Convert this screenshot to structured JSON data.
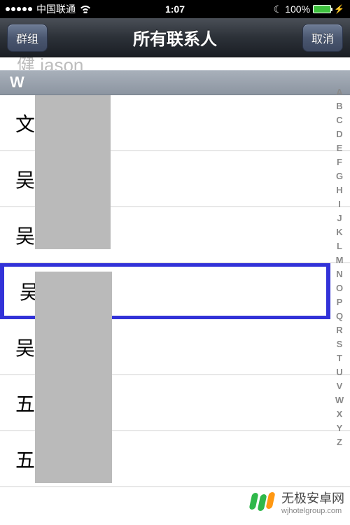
{
  "status": {
    "carrier": "中国联通",
    "time": "1:07",
    "battery": "100%"
  },
  "nav": {
    "left": "群组",
    "title": "所有联系人",
    "right": "取消"
  },
  "partial_contact": "健 jason",
  "section": "W",
  "contacts": [
    {
      "prefix": "文",
      "highlighted": false
    },
    {
      "prefix": "吴",
      "highlighted": false
    },
    {
      "prefix": "吴",
      "highlighted": false
    },
    {
      "prefix": "吴",
      "highlighted": true
    },
    {
      "prefix": "吴",
      "highlighted": false
    },
    {
      "prefix": "五",
      "highlighted": false
    },
    {
      "prefix": "五",
      "highlighted": false
    }
  ],
  "index_letters": [
    "A",
    "B",
    "C",
    "D",
    "E",
    "F",
    "G",
    "H",
    "I",
    "J",
    "K",
    "L",
    "M",
    "N",
    "O",
    "P",
    "Q",
    "R",
    "S",
    "T",
    "U",
    "V",
    "W",
    "X",
    "Y",
    "Z"
  ],
  "watermark": {
    "name": "无极安卓网",
    "url": "wjhotelgroup.com"
  }
}
